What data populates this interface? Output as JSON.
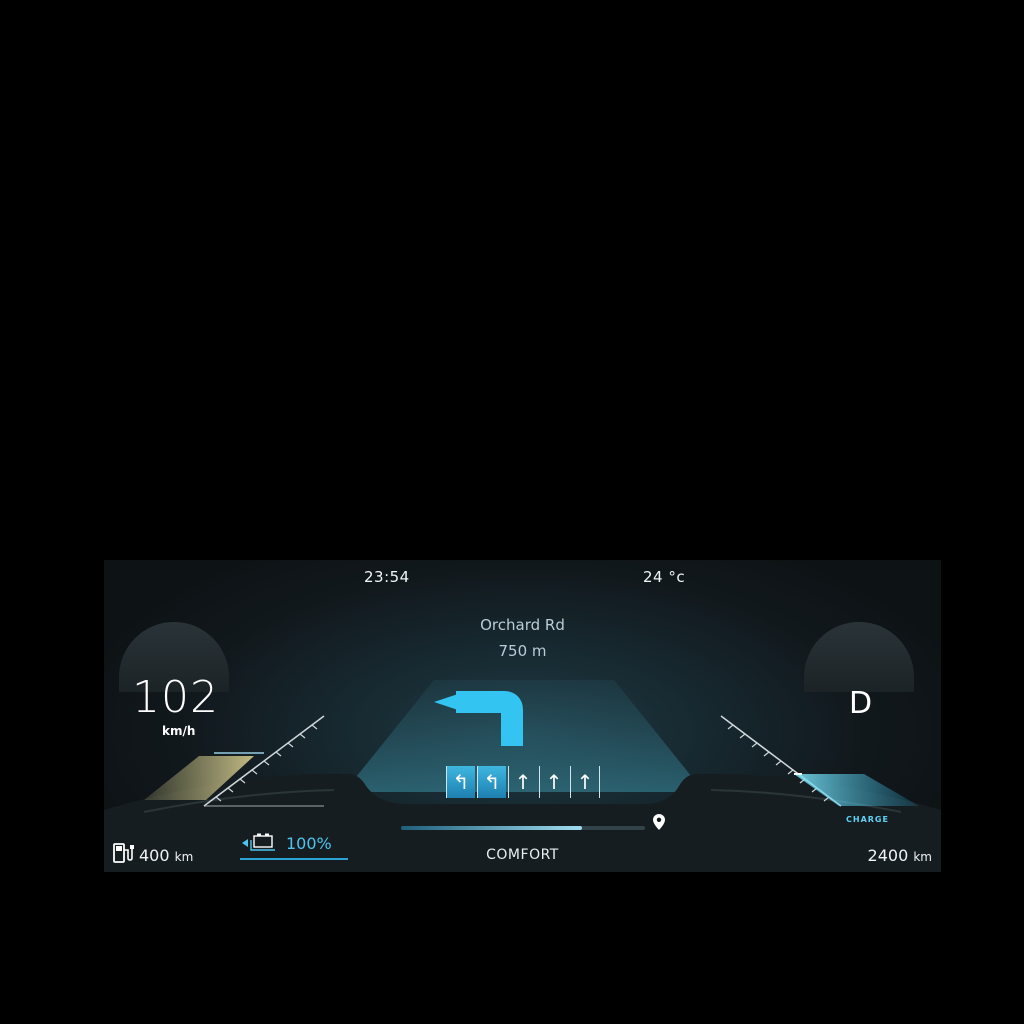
{
  "status": {
    "time": "23:54",
    "temperature": "24 °c"
  },
  "navigation": {
    "street": "Orchard Rd",
    "distance": "750 m",
    "turn_icon": "turn-left-arrow-icon",
    "lanes": [
      {
        "icon": "lane-left-turn-icon",
        "glyph": "↰",
        "active": true
      },
      {
        "icon": "lane-left-turn-icon",
        "glyph": "↰",
        "active": true
      },
      {
        "icon": "lane-straight-icon",
        "glyph": "↑",
        "active": false
      },
      {
        "icon": "lane-straight-icon",
        "glyph": "↑",
        "active": false
      },
      {
        "icon": "lane-straight-icon",
        "glyph": "↑",
        "active": false
      }
    ],
    "route_progress": 0.74,
    "destination_icon": "map-pin-icon"
  },
  "speed": {
    "value": "102",
    "unit": "km/h"
  },
  "gear": "D",
  "battery": {
    "percent": "100%",
    "icon": "battery-icon"
  },
  "range_left": {
    "value": "400",
    "unit": "km",
    "icon": "ev-charger-icon"
  },
  "drive_mode": "COMFORT",
  "range_right": {
    "value": "2400",
    "unit": "km"
  },
  "regen_label": "CHARGE",
  "colors": {
    "accent": "#3fc0ee",
    "background": "#11181c",
    "yellow_glow": "#d8d08a"
  }
}
